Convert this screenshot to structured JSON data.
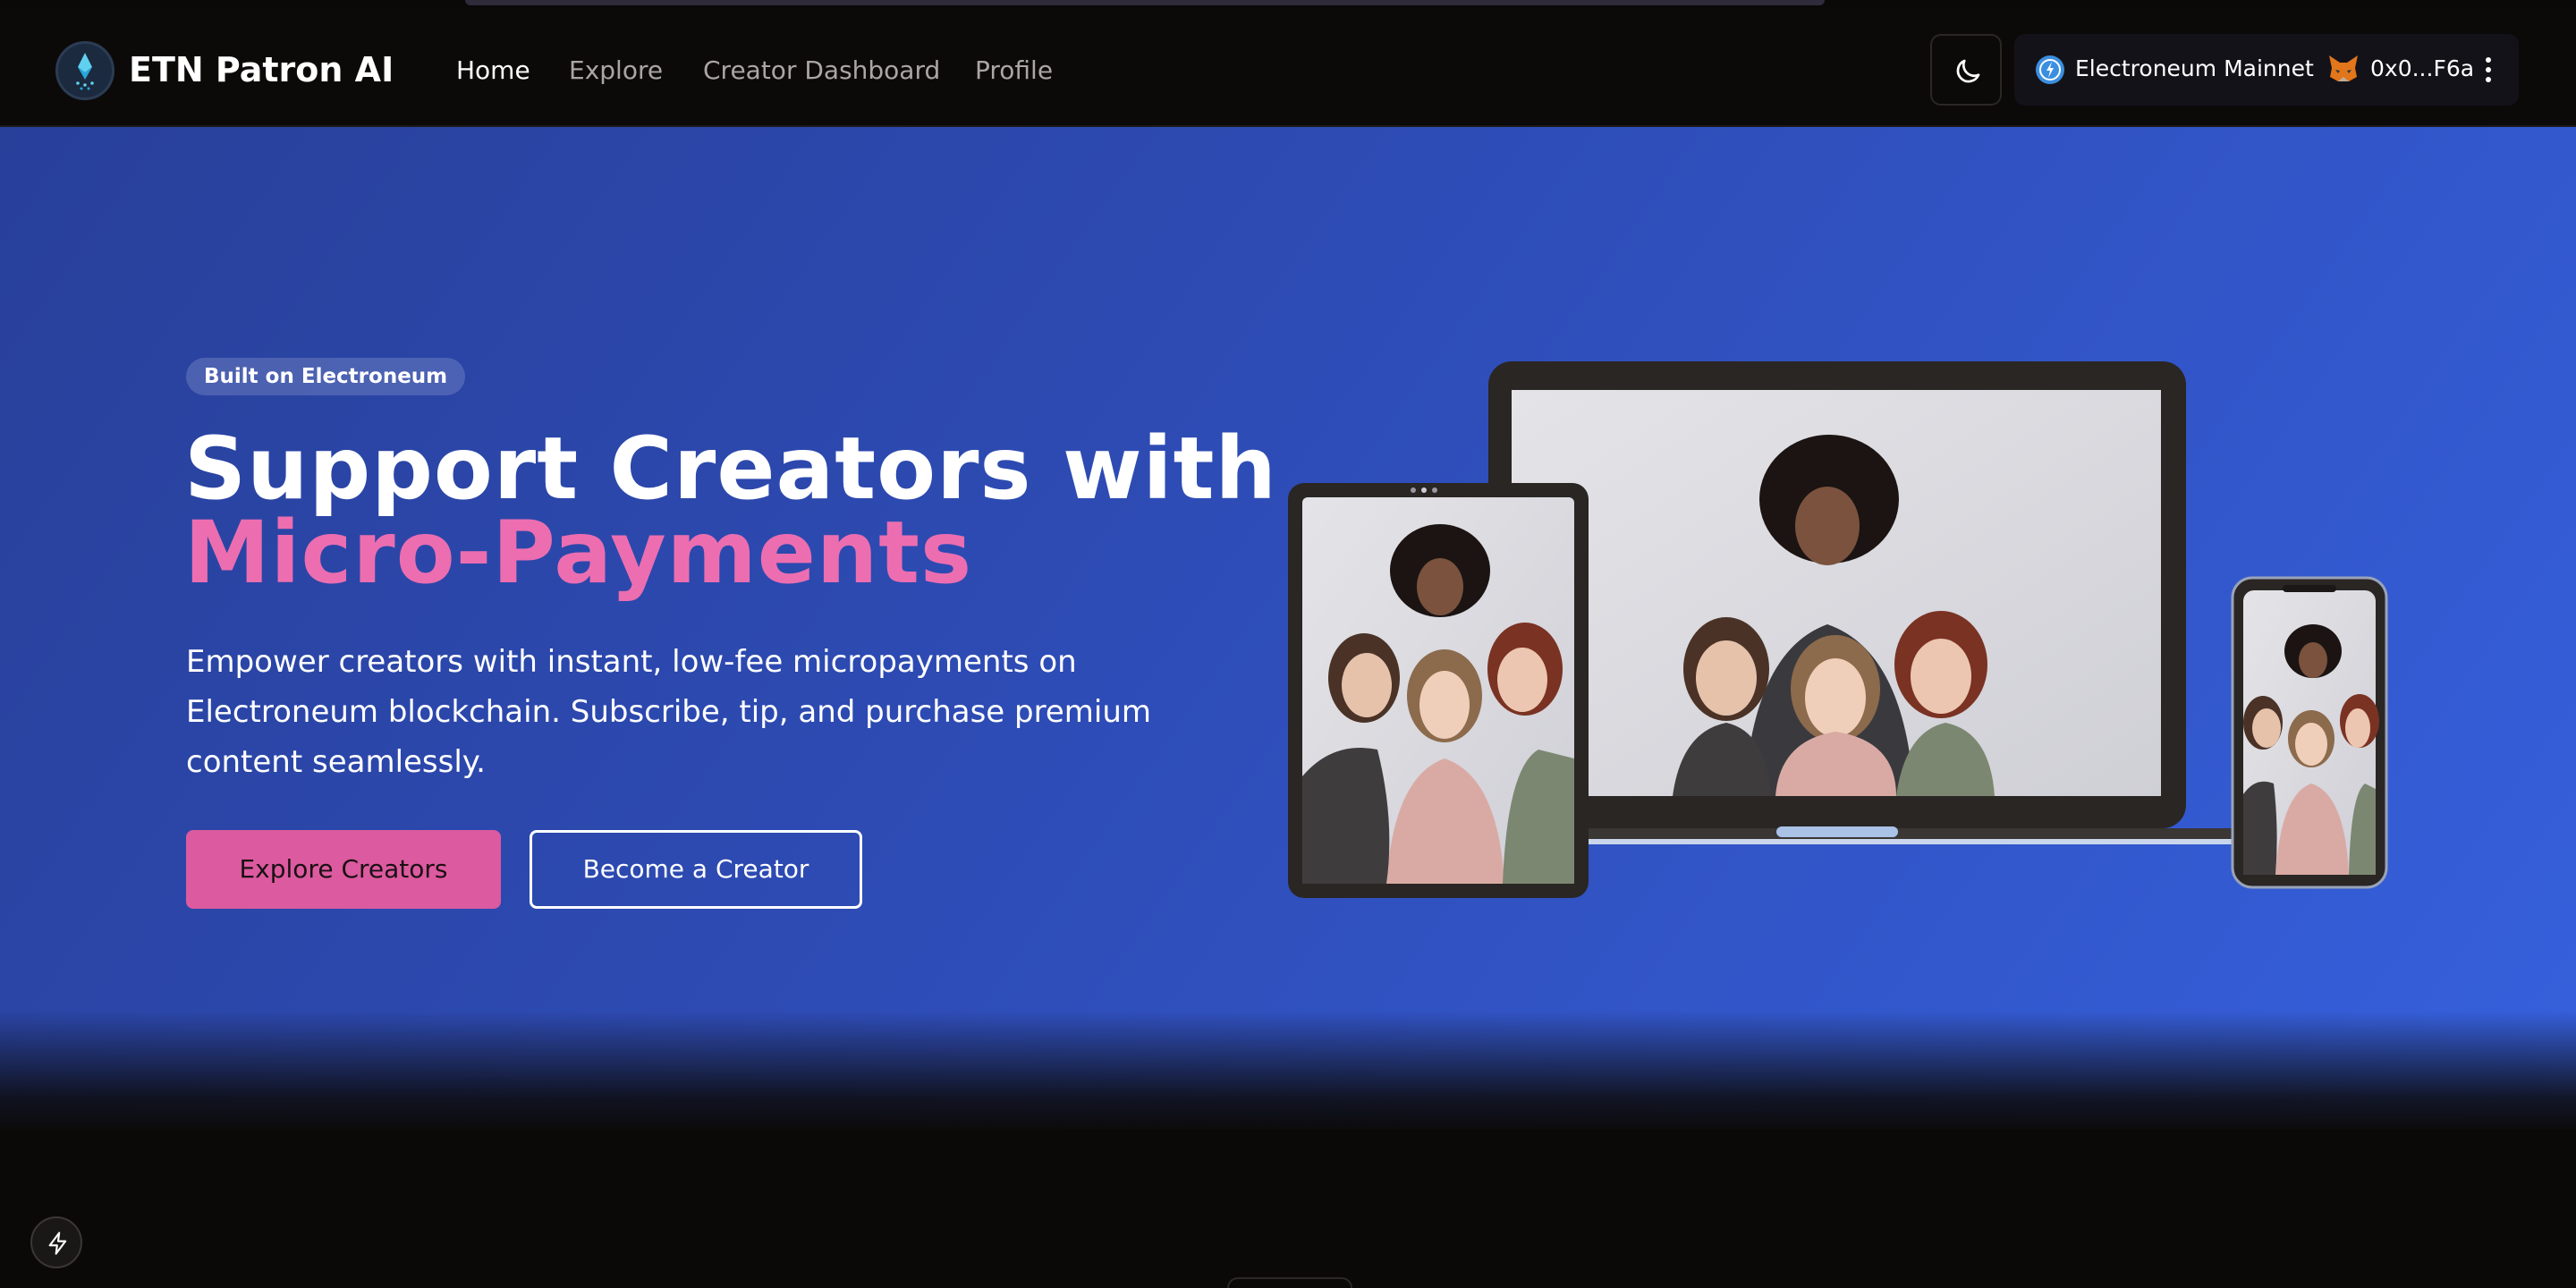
{
  "nav": {
    "brand": "ETN Patron AI",
    "links": [
      {
        "label": "Home",
        "active": true
      },
      {
        "label": "Explore",
        "active": false
      },
      {
        "label": "Creator Dashboard",
        "active": false
      },
      {
        "label": "Profile",
        "active": false
      }
    ],
    "theme_toggle_icon": "moon-icon",
    "network": {
      "name": "Electroneum Mainnet",
      "icon": "electroneum-network-icon"
    },
    "account": {
      "address": "0x0...F6a",
      "icon": "metamask-fox-icon",
      "menu_icon": "kebab-menu-icon"
    }
  },
  "hero": {
    "badge": "Built on Electroneum",
    "headline_line1": "Support Creators with",
    "headline_line2": "Micro-Payments",
    "description": "Empower creators with instant, low-fee micropayments on Electroneum blockchain. Subscribe, tip, and purchase premium content seamlessly.",
    "primary_cta": "Explore Creators",
    "secondary_cta": "Become a Creator",
    "illustration": "devices-mockup-laptop-tablet-phone"
  },
  "colors": {
    "accent_pink": "#ec6eb0",
    "button_pink": "#dc5a9f",
    "hero_blue_start": "#28409a",
    "hero_blue_end": "#3660dd",
    "nav_bg": "#0c0a09"
  },
  "floating_button_icon": "lightning-icon"
}
